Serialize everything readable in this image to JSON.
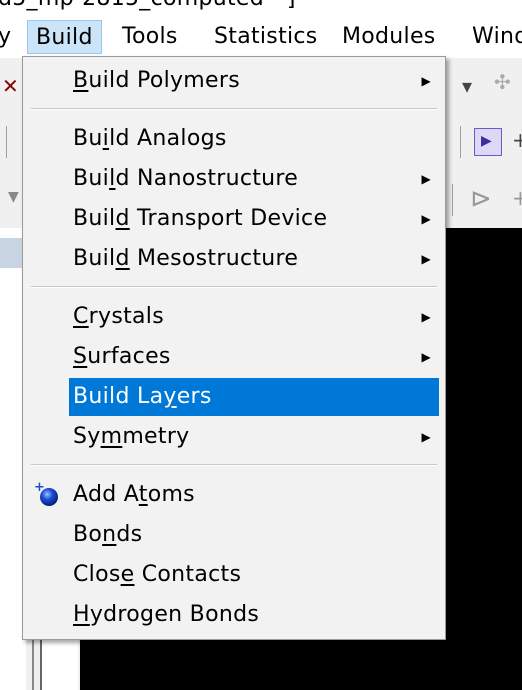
{
  "window": {
    "title_fragment": "d5_mp-2815_computed - ]"
  },
  "menubar": {
    "items": [
      {
        "label": "y",
        "active": false
      },
      {
        "label": "Build",
        "active": true
      },
      {
        "label": "Tools",
        "active": false
      },
      {
        "label": "Statistics",
        "active": false
      },
      {
        "label": "Modules",
        "active": false
      },
      {
        "label": "Wind",
        "active": false
      }
    ]
  },
  "build_menu": {
    "items": [
      {
        "label_pre": "",
        "mnemonic": "B",
        "label_post": "uild Polymers",
        "submenu": true,
        "highlighted": false
      },
      {
        "label_pre": "Bu",
        "mnemonic": "i",
        "label_post": "ld Analogs",
        "submenu": false,
        "highlighted": false
      },
      {
        "label_pre": "Bui",
        "mnemonic": "l",
        "label_post": "d Nanostructure",
        "submenu": true,
        "highlighted": false
      },
      {
        "label_pre": "Buil",
        "mnemonic": "d",
        "label_post": " Transport Device",
        "submenu": true,
        "highlighted": false
      },
      {
        "label_pre": "Buil",
        "mnemonic": "d",
        "label_post": " Mesostructure",
        "submenu": true,
        "highlighted": false
      },
      {
        "label_pre": "",
        "mnemonic": "C",
        "label_post": "rystals",
        "submenu": true,
        "highlighted": false
      },
      {
        "label_pre": "",
        "mnemonic": "S",
        "label_post": "urfaces",
        "submenu": true,
        "highlighted": false
      },
      {
        "label_pre": "Build La",
        "mnemonic": "y",
        "label_post": "ers",
        "submenu": false,
        "highlighted": true
      },
      {
        "label_pre": "Sy",
        "mnemonic": "m",
        "label_post": "metry",
        "submenu": true,
        "highlighted": false
      },
      {
        "label_pre": "Add A",
        "mnemonic": "t",
        "label_post": "oms",
        "submenu": false,
        "highlighted": false,
        "icon": "add-atom-icon"
      },
      {
        "label_pre": "Bo",
        "mnemonic": "n",
        "label_post": "ds",
        "submenu": false,
        "highlighted": false
      },
      {
        "label_pre": "Clos",
        "mnemonic": "e",
        "label_post": " Contacts",
        "submenu": false,
        "highlighted": false
      },
      {
        "label_pre": "",
        "mnemonic": "H",
        "label_post": "ydrogen Bonds",
        "submenu": false,
        "highlighted": false
      }
    ]
  },
  "colors": {
    "highlight": "#0078d7",
    "viewport_background": "#000000",
    "atom_blue": "#1a4fd6"
  }
}
